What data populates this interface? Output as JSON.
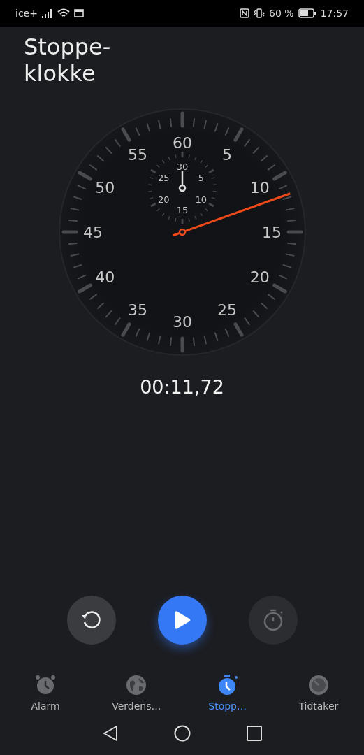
{
  "status_bar": {
    "carrier": "ice+",
    "battery_text": "60 %",
    "time": "17:57"
  },
  "title": "Stoppe-klokke",
  "dial": {
    "numbers": [
      "60",
      "5",
      "10",
      "15",
      "20",
      "25",
      "30",
      "35",
      "40",
      "45",
      "50",
      "55"
    ],
    "sub_numbers": [
      "30",
      "5",
      "10",
      "15",
      "20",
      "25"
    ]
  },
  "elapsed": "00:11,72",
  "controls": [
    {
      "kind": "reset",
      "disabled": false
    },
    {
      "kind": "start",
      "disabled": false
    },
    {
      "kind": "lap",
      "disabled": true
    }
  ],
  "tabs": [
    {
      "label": "Alarm",
      "kind": "alarm",
      "selected": false
    },
    {
      "label": "Verdens…",
      "kind": "world",
      "selected": false
    },
    {
      "label": "Stopp…",
      "kind": "stopwatch",
      "selected": true
    },
    {
      "label": "Tidtaker",
      "kind": "timer",
      "selected": false
    }
  ]
}
